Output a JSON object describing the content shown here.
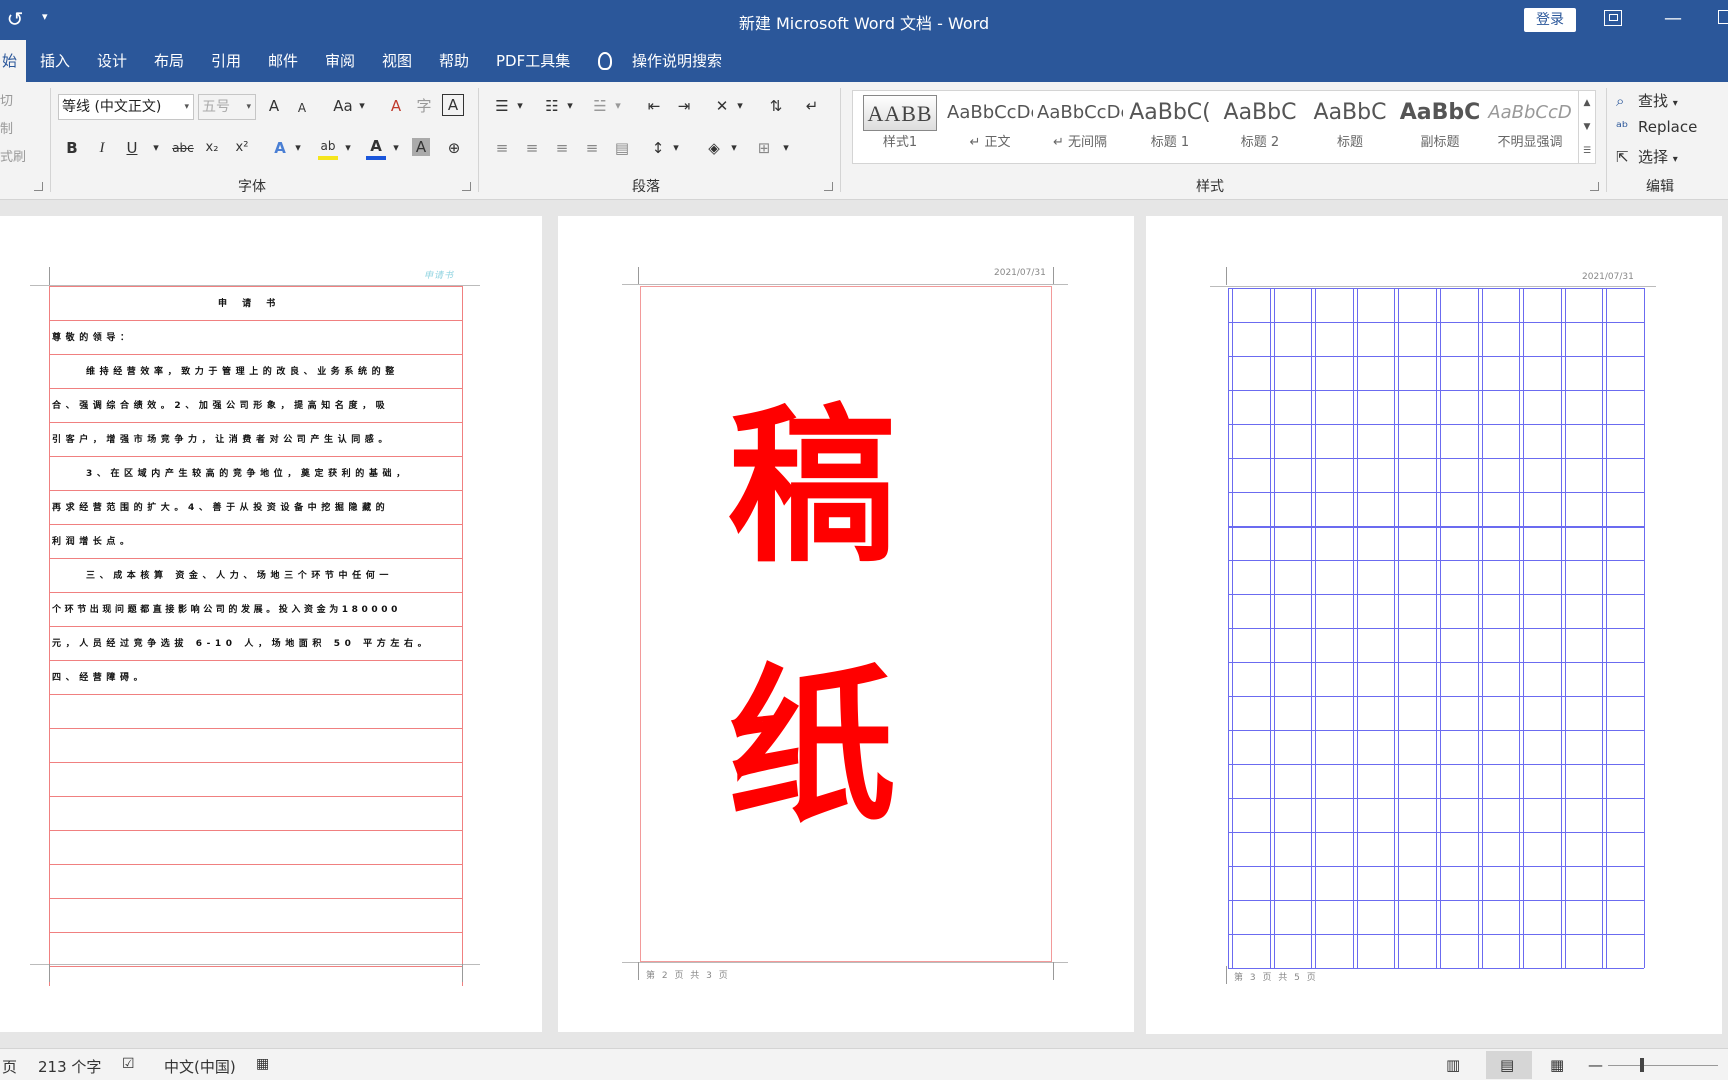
{
  "titlebar": {
    "qa_glyph": "▾",
    "title": "新建 Microsoft Word 文档 - Word",
    "login": "登录",
    "minimize_glyph": "—"
  },
  "tabs": [
    "始",
    "插入",
    "设计",
    "布局",
    "引用",
    "邮件",
    "审阅",
    "视图",
    "帮助",
    "PDF工具集",
    "操作说明搜索"
  ],
  "clipboard": {
    "cut": "切",
    "copy": "制",
    "format": "式刷"
  },
  "font": {
    "name": "等线 (中文正文)",
    "size": "五号",
    "group_label": "字体",
    "bold": "B",
    "italic": "I",
    "underline": "U",
    "strike": "abc",
    "sub": "x₂",
    "sup": "x²",
    "grow": "A",
    "shrink": "A",
    "case": "Aa",
    "effects": "A",
    "font_color": "A",
    "shade": "A",
    "circle": "⊕",
    "clear": "A",
    "phonetic": "字",
    "border": "A",
    "highlight_color": "#f5e51c",
    "font_color_bar": "#1a56db"
  },
  "paragraph": {
    "group_label": "段落"
  },
  "styles": {
    "group_label": "样式",
    "items": [
      {
        "sample": "AABB",
        "name": "样式1"
      },
      {
        "sample": "AaBbCcDc",
        "name": "↵ 正文"
      },
      {
        "sample": "AaBbCcDc",
        "name": "↵ 无间隔"
      },
      {
        "sample": "AaBbC(",
        "name": "标题 1"
      },
      {
        "sample": "AaBbC",
        "name": "标题 2"
      },
      {
        "sample": "AaBbC",
        "name": "标题"
      },
      {
        "sample": "AaBbC",
        "name": "副标题"
      },
      {
        "sample": "AaBbCcD",
        "name": "不明显强调"
      }
    ]
  },
  "editing": {
    "find": "查找",
    "replace": "Replace",
    "select": "选择",
    "group_label": "编辑"
  },
  "page1": {
    "header": "申请书",
    "title": "申 请 书",
    "lines": [
      "尊敬的领导：",
      "维持经营效率，致力于管理上的改良、业务系统的整",
      "合、强调综合绩效。2、加强公司形象，提高知名度，吸",
      "引客户，增强市场竞争力，让消费者对公司产生认同感。",
      "3、在区域内产生较高的竞争地位，奠定获利的基础，",
      "再求经营范围的扩大。4、善于从投资设备中挖掘隐藏的",
      "利润增长点。",
      "三、成本核算  资金、人力、场地三个环节中任何一",
      "个环节出现问题都直接影响公司的发展。投入资金为180000",
      "元，人员经过竞争选拔 6-10 人，场地面积 50 平方左右。",
      "四、经营障碍。"
    ]
  },
  "page2": {
    "date": "2021/07/31",
    "char1": "稿",
    "char2": "纸",
    "footer": "第 2 页 共 3 页",
    "char_color": "#ff0000"
  },
  "page3": {
    "date": "2021/07/31",
    "footer": "第 3 页 共 5 页",
    "grid_color": "#6b6bf0"
  },
  "status": {
    "page": "页",
    "words": "213 个字",
    "lang": "中文(中国)",
    "zoom_minus": "—"
  }
}
